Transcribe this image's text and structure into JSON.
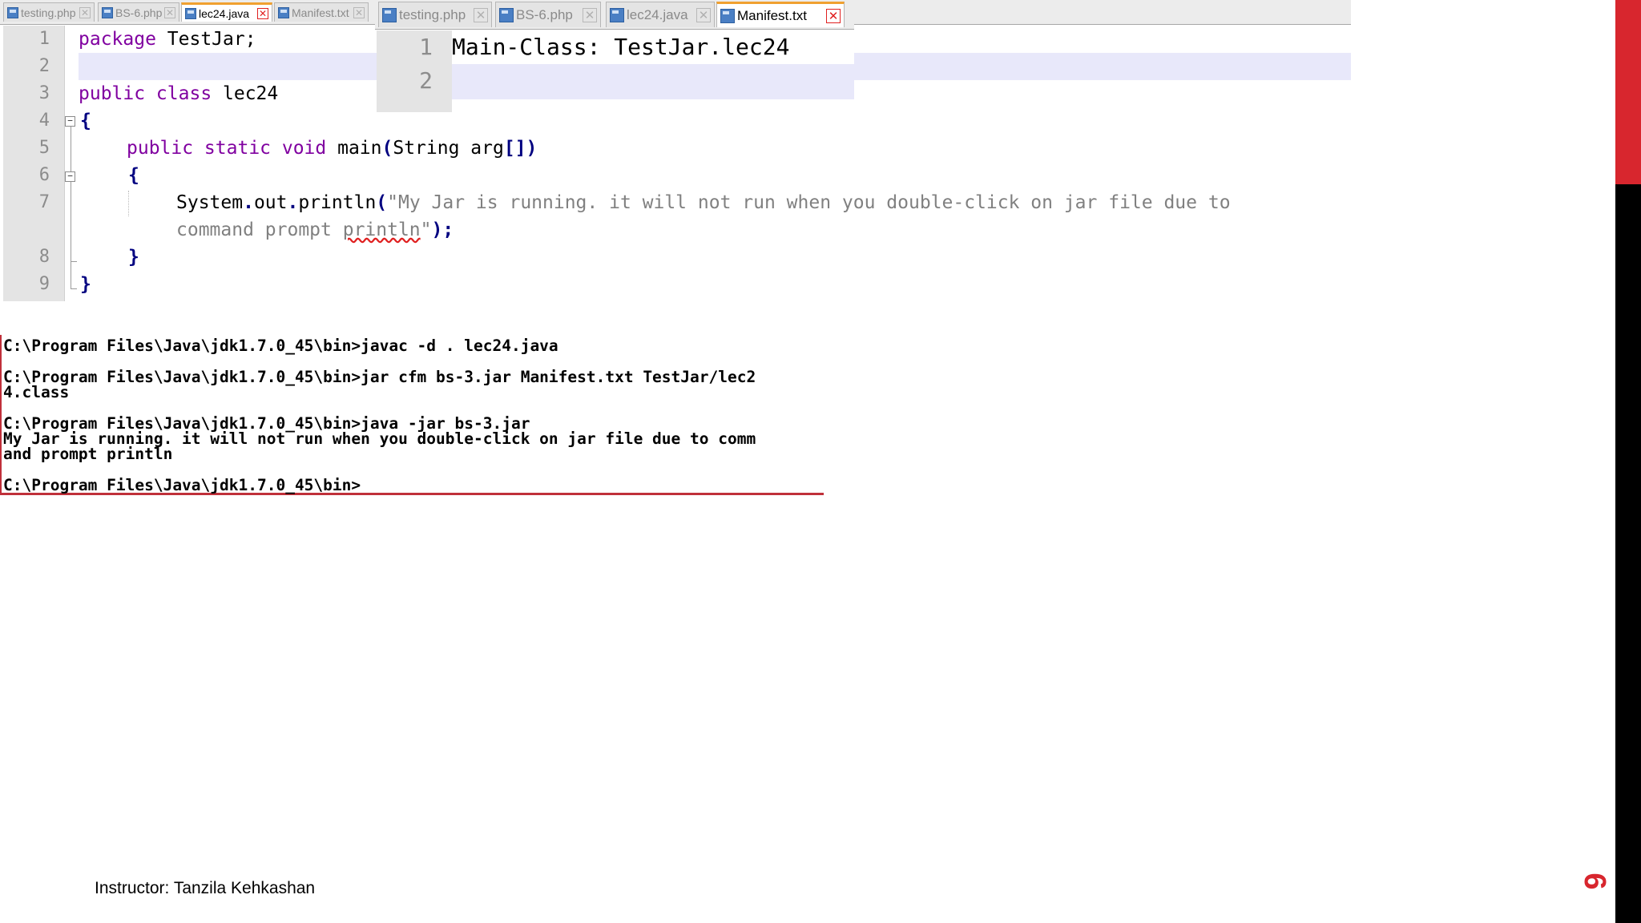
{
  "editor_a": {
    "tabs": [
      {
        "label": "testing.php"
      },
      {
        "label": "BS-6.php"
      },
      {
        "label": "lec24.java"
      },
      {
        "label": "Manifest.txt"
      }
    ],
    "line_numbers": [
      "1",
      "2",
      "3",
      "4",
      "5",
      "6",
      "7",
      "8",
      "9"
    ],
    "code": {
      "l1_kw": "package",
      "l1_rest": " TestJar;",
      "l3_kw": "public class",
      "l3_rest": " lec24",
      "l4": "{",
      "l5_kw": "public static void",
      "l5_name": " main",
      "l5_open": "(",
      "l5_args": "String arg",
      "l5_close": "[])",
      "l6": "{",
      "l7_call": "System",
      "l7_dot1": ".",
      "l7_out": "out",
      "l7_dot2": ".",
      "l7_fn": "println",
      "l7_open": "(",
      "l7_str1": "\"My Jar is running. it will not run when you double-click on jar file due to",
      "l7_str2a": "command prompt ",
      "l7_str2b": "println",
      "l7_str2c": "\"",
      "l7_end": ");",
      "l8": "}",
      "l9": "}"
    }
  },
  "editor_b": {
    "tabs": [
      {
        "label": "testing.php"
      },
      {
        "label": "BS-6.php"
      },
      {
        "label": "lec24.java"
      },
      {
        "label": "Manifest.txt"
      }
    ],
    "line_numbers": [
      "1",
      "2"
    ],
    "code_line_1": "Main-Class: TestJar.lec24"
  },
  "console": {
    "lines": [
      "C:\\Program Files\\Java\\jdk1.7.0_45\\bin>javac -d . lec24.java",
      "C:\\Program Files\\Java\\jdk1.7.0_45\\bin>jar cfm bs-3.jar Manifest.txt TestJar/lec2",
      "4.class",
      "C:\\Program Files\\Java\\jdk1.7.0_45\\bin>java -jar bs-3.jar",
      "My Jar is running. it will not run when you double-click on jar file due to comm",
      "and prompt println",
      "C:\\Program Files\\Java\\jdk1.7.0_45\\bin>"
    ]
  },
  "footer": {
    "instructor": "Instructor: Tanzila Kehkashan"
  },
  "slide_number": "6",
  "colors": {
    "accent_red": "#d8262e",
    "keyword": "#8000a0",
    "brace": "#000080",
    "string": "#808080",
    "active_tab_top": "#f0a030"
  }
}
